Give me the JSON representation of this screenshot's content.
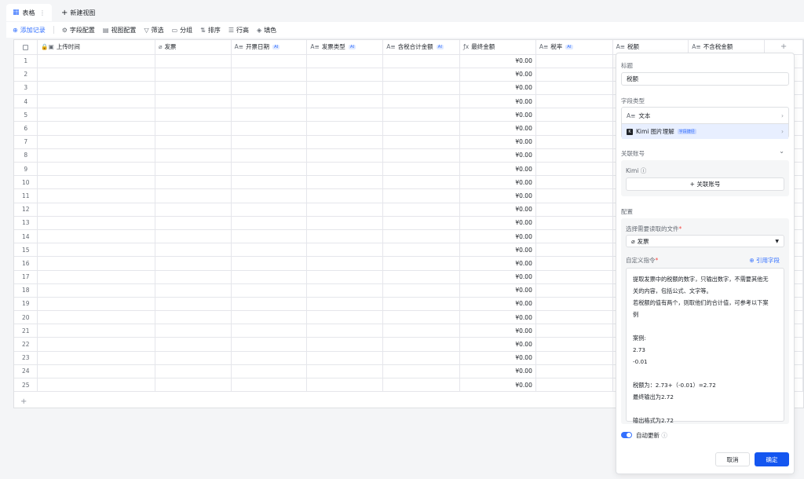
{
  "tabs": {
    "active_label": "表格",
    "new_view_label": "新建视图"
  },
  "toolbar": {
    "add_record": "添加记录",
    "field_config": "字段配置",
    "view_config": "视图配置",
    "filter": "筛选",
    "group": "分组",
    "sort": "排序",
    "row_height": "行高",
    "fill_color": "填色"
  },
  "table": {
    "columns": [
      {
        "label": "上传时间",
        "icon": "lock-calendar-icon",
        "ai": false
      },
      {
        "label": "发票",
        "icon": "attachment-icon",
        "ai": false
      },
      {
        "label": "开票日期",
        "icon": "text-icon",
        "ai": true
      },
      {
        "label": "发票类型",
        "icon": "text-icon",
        "ai": true
      },
      {
        "label": "含税合计金额",
        "icon": "text-icon",
        "ai": true
      },
      {
        "label": "最终金额",
        "icon": "formula-icon",
        "ai": false
      },
      {
        "label": "税率",
        "icon": "text-icon",
        "ai": true
      },
      {
        "label": "税额",
        "icon": "text-icon",
        "ai": false
      },
      {
        "label": "不含税金额",
        "icon": "text-icon",
        "ai": false
      }
    ],
    "ai_badge": "AI",
    "final_amount_value": "¥0.00",
    "row_numbers": [
      "1",
      "2",
      "3",
      "4",
      "5",
      "6",
      "7",
      "8",
      "9",
      "10",
      "11",
      "12",
      "13",
      "14",
      "15",
      "16",
      "17",
      "18",
      "19",
      "20",
      "21",
      "22",
      "23",
      "24",
      "25"
    ]
  },
  "panel": {
    "title_label": "标题",
    "title_value": "税额",
    "field_type_label": "字段类型",
    "type_text": "文本",
    "type_kimi": "Kimi 图片理解",
    "type_kimi_badge": "字段捷径",
    "linked_account_label": "关联账号",
    "kimi_label": "Kimi",
    "link_account_button": "+ 关联账号",
    "config_label": "配置",
    "select_file_label": "选择需要读取的文件",
    "select_file_value": "发票",
    "custom_prompt_label": "自定义指令",
    "reference_field": "引用字段",
    "prompt_lines": [
      "提取发票中的税额的数字，只输出数字，不需要其他无",
      "关的内容，包括公式、文字等。",
      "若税额的值有两个，则取他们的合计值，可参考以下案",
      "例",
      "",
      "案例:",
      "2.73",
      "-0.01",
      "",
      "税额为：2.73+（-0.01）=2.72",
      "最终输出为2.72",
      "",
      "输出格式为2.72"
    ],
    "auto_update": "自动更新",
    "cancel": "取消",
    "confirm": "确定"
  }
}
